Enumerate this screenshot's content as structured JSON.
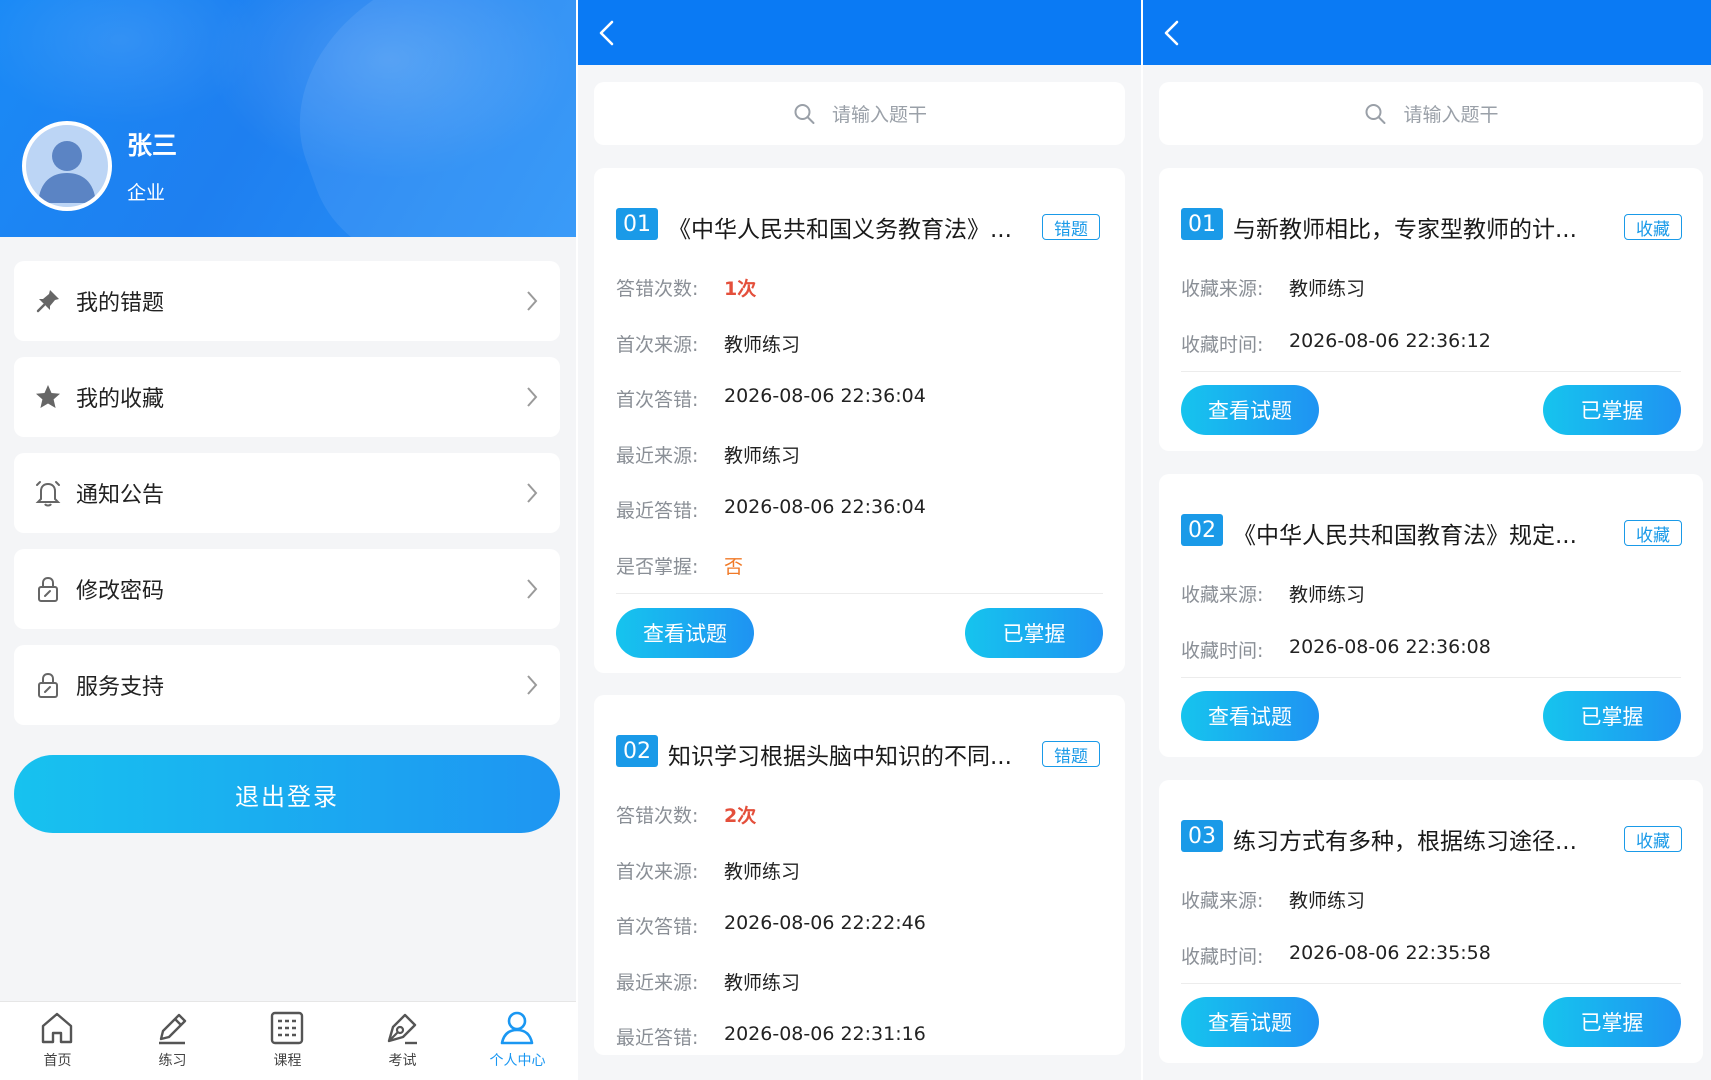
{
  "profile": {
    "name": "张三",
    "role": "企业",
    "menu": [
      {
        "label": "我的错题",
        "icon": "pin-icon"
      },
      {
        "label": "我的收藏",
        "icon": "star-icon"
      },
      {
        "label": "通知公告",
        "icon": "bell-icon"
      },
      {
        "label": "修改密码",
        "icon": "lock-icon"
      },
      {
        "label": "服务支持",
        "icon": "lock-icon"
      }
    ],
    "logout_label": "退出登录",
    "tabs": [
      {
        "label": "首页",
        "icon": "home-icon"
      },
      {
        "label": "练习",
        "icon": "pencil-icon"
      },
      {
        "label": "课程",
        "icon": "grid-icon"
      },
      {
        "label": "考试",
        "icon": "pen-nib-icon"
      },
      {
        "label": "个人中心",
        "icon": "user-icon",
        "active": true
      }
    ]
  },
  "wrong": {
    "search_placeholder": "请输入题干",
    "tag": "错题",
    "labels": {
      "count": "答错次数:",
      "first_source": "首次来源:",
      "first_time": "首次答错:",
      "last_source": "最近来源:",
      "last_time": "最近答错:",
      "mastered": "是否掌握:"
    },
    "items": [
      {
        "num": "01",
        "title": "《中华人民共和国义务教育法》...",
        "count": "1次",
        "first_source": "教师练习",
        "first_time": "2026-08-06 22:36:04",
        "last_source": "教师练习",
        "last_time": "2026-08-06 22:36:04",
        "mastered": "否"
      },
      {
        "num": "02",
        "title": "知识学习根据头脑中知识的不同...",
        "count": "2次",
        "first_source": "教师练习",
        "first_time": "2026-08-06 22:22:46",
        "last_source": "教师练习",
        "last_time": "2026-08-06 22:31:16"
      }
    ],
    "view_label": "查看试题",
    "master_label": "已掌握"
  },
  "favorites": {
    "search_placeholder": "请输入题干",
    "tag": "收藏",
    "labels": {
      "source": "收藏来源:",
      "time": "收藏时间:"
    },
    "items": [
      {
        "num": "01",
        "title": "与新教师相比，专家型教师的计...",
        "source": "教师练习",
        "time": "2026-08-06 22:36:12"
      },
      {
        "num": "02",
        "title": "《中华人民共和国教育法》规定...",
        "source": "教师练习",
        "time": "2026-08-06 22:36:08"
      },
      {
        "num": "03",
        "title": "练习方式有多种，根据练习途径...",
        "source": "教师练习",
        "time": "2026-08-06 22:35:58"
      }
    ],
    "view_label": "查看试题",
    "master_label": "已掌握"
  },
  "colors": {
    "primary": "#0a7af4",
    "accent": "#1a9ae8",
    "danger": "#e44f3b",
    "warning": "#f07a28"
  }
}
